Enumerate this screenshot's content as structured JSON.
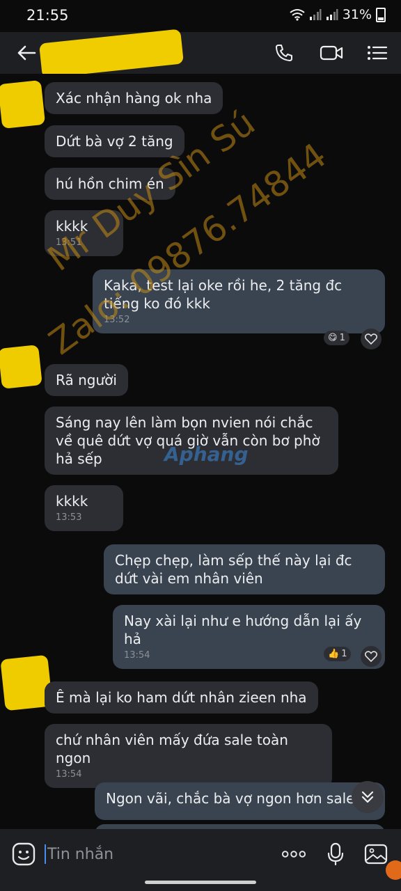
{
  "status": {
    "time": "21:55",
    "battery": "31%"
  },
  "header": {
    "title_censored": true
  },
  "messages": [
    {
      "dir": "in",
      "text": "Xác nhận hàng ok nha"
    },
    {
      "dir": "in",
      "text": "Dứt bà vợ 2 tăng"
    },
    {
      "dir": "in",
      "text": "hú hồn chim én"
    },
    {
      "dir": "in",
      "text": "kkkk",
      "time": "13:51"
    },
    {
      "dir": "out",
      "text": "Kaka, test lại oke rồi he, 2 tăng đc tiếng ko đó kkk",
      "time": "13:52",
      "reaction_count": "1"
    },
    {
      "dir": "in",
      "text": "Rã người"
    },
    {
      "dir": "in",
      "text": "Sáng nay lên làm bọn nvien nói chắc về quê dứt vợ quá giờ vẫn còn bơ phờ hả sếp"
    },
    {
      "dir": "in",
      "text": "kkkk",
      "time": "13:53"
    },
    {
      "dir": "out",
      "text": "Chẹp chẹp, làm sếp thế này lại đc dứt vài em nhân viên"
    },
    {
      "dir": "out",
      "text": "Nay xài lại như e hướng dẫn lại ấy hả",
      "time": "13:54",
      "reaction_count": "1"
    },
    {
      "dir": "in",
      "text": "Ê mà lại ko ham dứt nhân zieen nha"
    },
    {
      "dir": "in",
      "text": "chứ nhân viên mấy đứa sale toàn ngon",
      "time": "13:54"
    },
    {
      "dir": "out",
      "text": "Ngon vãi, chắc bà vợ ngon hơn sale"
    }
  ],
  "watermark": {
    "line1": "Mr Duy Sìn Sú",
    "line2": "Zalo: 09876.74844",
    "logo": "Aphang"
  },
  "composer": {
    "placeholder": "Tin nhắn"
  },
  "colors": {
    "bg": "#0b0b0c",
    "bubble_in": "#2d2e33",
    "bubble_out": "#3a4350",
    "accent": "#4a8df0",
    "watermark": "#c48c14"
  },
  "icons": [
    "back-arrow-icon",
    "phone-icon",
    "video-icon",
    "list-menu-icon",
    "emoji-icon",
    "more-icon",
    "mic-icon",
    "image-icon",
    "heart-icon",
    "chevron-down-icon"
  ]
}
